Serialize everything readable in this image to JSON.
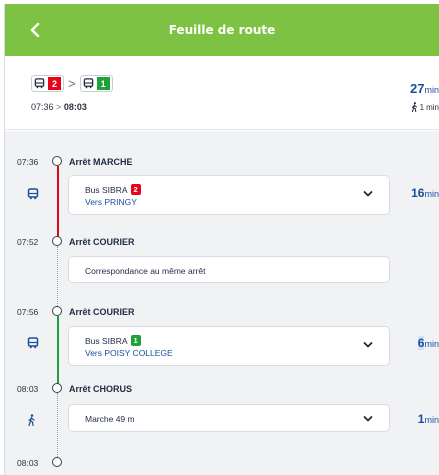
{
  "header": {
    "title": "Feuille de route",
    "back_icon": "chevron-left-icon"
  },
  "summary": {
    "lines": [
      {
        "mode_icon": "bus-icon",
        "number": "2",
        "color": "#e3061b"
      },
      {
        "mode_icon": "bus-icon",
        "number": "1",
        "color": "#1fa13a"
      }
    ],
    "separator": ">",
    "depart": "07:36",
    "arrow": ">",
    "arrive": "08:03",
    "duration_value": "27",
    "duration_unit": "min",
    "walk_value": "1",
    "walk_unit": "min"
  },
  "steps": [
    {
      "time": "07:36",
      "stop": "Arrêt MARCHE"
    },
    {
      "leg_type": "bus",
      "line_label": "Bus SIBRA",
      "line_number": "2",
      "line_color": "#e3061b",
      "direction": "Vers PRINGY",
      "duration_value": "16",
      "duration_unit": "min"
    },
    {
      "time": "07:52",
      "stop": "Arrêt COURIER"
    },
    {
      "leg_type": "transfer",
      "text": "Correspondance au même arrêt"
    },
    {
      "time": "07:56",
      "stop": "Arrêt COURIER"
    },
    {
      "leg_type": "bus",
      "line_label": "Bus SIBRA",
      "line_number": "1",
      "line_color": "#1fa13a",
      "direction": "Vers POISY COLLEGE",
      "duration_value": "6",
      "duration_unit": "min"
    },
    {
      "time": "08:03",
      "stop": "Arrêt CHORUS"
    },
    {
      "leg_type": "walk",
      "text": "Marche 49 m",
      "duration_value": "1",
      "duration_unit": "min"
    },
    {
      "time": "08:03",
      "stop": ""
    }
  ],
  "colors": {
    "header": "#7dc242",
    "accent_blue": "#1b4fa0",
    "line2_red": "#e3061b",
    "line1_green": "#1fa13a"
  }
}
